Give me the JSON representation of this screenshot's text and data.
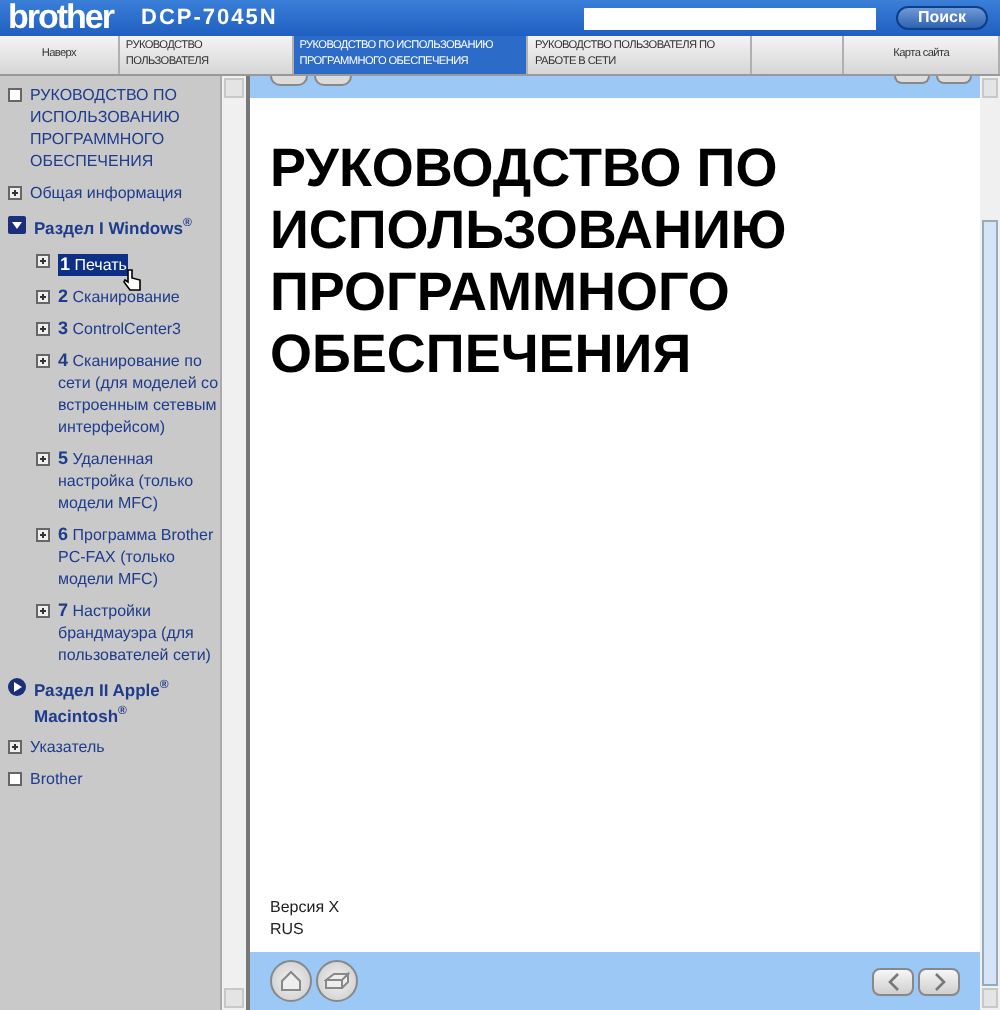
{
  "header": {
    "brand": "brother",
    "model": "DCP-7045N",
    "search_button": "Поиск"
  },
  "tabs": [
    {
      "label": "Наверх",
      "selected": false
    },
    {
      "label": "РУКОВОДСТВО ПОЛЬЗОВАТЕЛЯ",
      "selected": false
    },
    {
      "label": "РУКОВОДСТВО ПО ИСПОЛЬЗОВАНИЮ ПРОГРАММНОГО ОБЕСПЕЧЕНИЯ",
      "selected": true
    },
    {
      "label": "РУКОВОДСТВО ПОЛЬЗОВАТЕЛЯ ПО РАБОТЕ В СЕТИ",
      "selected": false
    },
    {
      "label": "Карта сайта",
      "selected": false
    }
  ],
  "sidebar": {
    "items": [
      {
        "kind": "page",
        "label": "РУКОВОДСТВО ПО ИСПОЛЬЗОВАНИЮ ПРОГРАММНОГО ОБЕСПЕЧЕНИЯ",
        "selected": false
      },
      {
        "kind": "topic",
        "label": "Общая информация",
        "selected": false
      },
      {
        "kind": "section",
        "label": "Раздел I Windows",
        "mark": "®",
        "expanded": true,
        "children": [
          {
            "kind": "topic",
            "number": "1",
            "label": "Печать",
            "selected": true
          },
          {
            "kind": "topic",
            "number": "2",
            "label": "Сканирование",
            "selected": false
          },
          {
            "kind": "topic",
            "number": "3",
            "label": "ControlCenter3",
            "selected": false
          },
          {
            "kind": "topic",
            "number": "4",
            "label": "Сканирование по сети (для моделей со встроенным сетевым интерфейсом)",
            "selected": false
          },
          {
            "kind": "topic",
            "number": "5",
            "label": "Удаленная настройка (только модели MFC)",
            "selected": false
          },
          {
            "kind": "topic",
            "number": "6",
            "label": "Программа Brother PC-FAX (только модели MFC)",
            "selected": false
          },
          {
            "kind": "topic",
            "number": "7",
            "label": "Настройки брандмауэра (для пользователей сети)",
            "selected": false
          }
        ]
      },
      {
        "kind": "section",
        "label": "Раздел II Apple$^{®}$ Macintosh",
        "mark": "®",
        "expanded": false
      },
      {
        "kind": "topic",
        "label": "Указатель",
        "selected": false
      },
      {
        "kind": "page",
        "label": "Brother",
        "selected": false
      }
    ]
  },
  "content": {
    "title": "РУКОВОДСТВО ПО ИСПОЛЬЗОВАНИЮ ПРОГРАММНОГО ОБЕСПЕЧЕНИЯ",
    "version": "Версия X",
    "language": "RUS"
  }
}
